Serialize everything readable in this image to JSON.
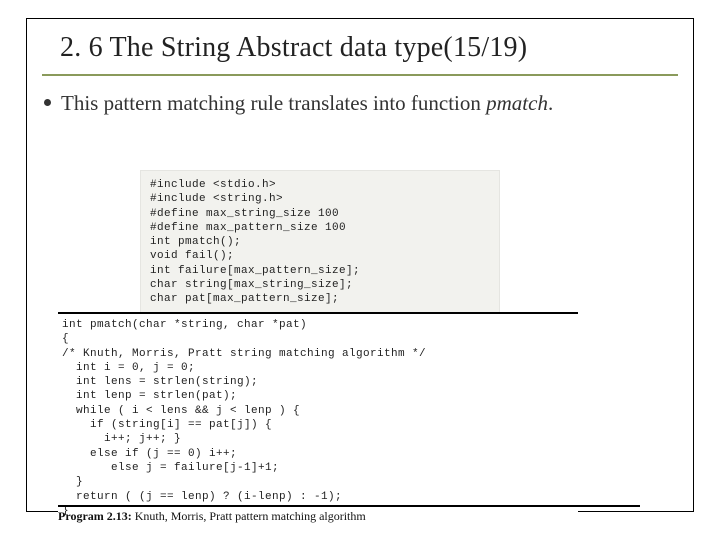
{
  "title": "2. 6 The String Abstract data type(15/19)",
  "bullet": {
    "prefix": "This pattern matching rule translates into function ",
    "ital": "pmatch",
    "suffix": "."
  },
  "code1": "#include <stdio.h>\n#include <string.h>\n#define max_string_size 100\n#define max_pattern_size 100\nint pmatch();\nvoid fail();\nint failure[max_pattern_size];\nchar string[max_string_size];\nchar pat[max_pattern_size];",
  "code2": "int pmatch(char *string, char *pat)\n{\n/* Knuth, Morris, Pratt string matching algorithm */\n  int i = 0, j = 0;\n  int lens = strlen(string);\n  int lenp = strlen(pat);\n  while ( i < lens && j < lenp ) {\n    if (string[i] == pat[j]) {\n      i++; j++; }\n    else if (j == 0) i++;\n       else j = failure[j-1]+1;\n  }\n  return ( (j == lenp) ? (i-lenp) : -1);\n}",
  "caption": {
    "label": "Program 2.13:",
    "text": " Knuth, Morris, Pratt pattern matching algorithm"
  }
}
